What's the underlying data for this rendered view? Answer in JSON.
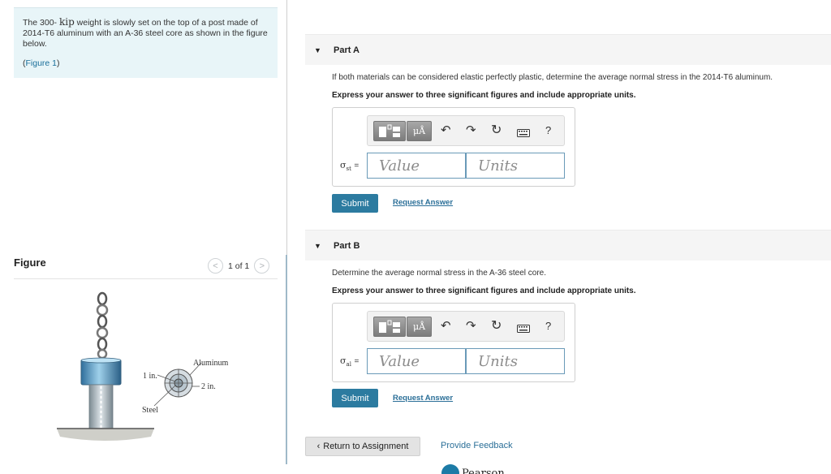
{
  "problem": {
    "text_before": "The 300-",
    "unit": "kip",
    "text_after": "weight is slowly set on the top of a post made of 2014-T6 aluminum with an A-36 steel core as shown in the figure below.",
    "figure_link": "Figure 1"
  },
  "figure_panel": {
    "heading": "Figure",
    "pager_text": "1 of 1",
    "prev_glyph": "<",
    "next_glyph": ">",
    "labels": {
      "aluminum": "Aluminum",
      "inner_dim": "1 in.",
      "outer_dim": "2 in.",
      "steel": "Steel"
    }
  },
  "parts": [
    {
      "title": "Part A",
      "caret": "▼",
      "question": "If both materials can be considered elastic perfectly plastic, determine the average normal stress in the 2014-T6 aluminum.",
      "instruction": "Express your answer to three significant figures and include appropriate units.",
      "symbol": "σ",
      "symbol_sub": "st",
      "equals": "=",
      "value_placeholder": "Value",
      "units_placeholder": "Units",
      "submit": "Submit",
      "request": "Request Answer"
    },
    {
      "title": "Part B",
      "caret": "▼",
      "question": "Determine the average normal stress in the A-36 steel core.",
      "instruction": "Express your answer to three significant figures and include appropriate units.",
      "symbol": "σ",
      "symbol_sub": "al",
      "equals": "=",
      "value_placeholder": "Value",
      "units_placeholder": "Units",
      "submit": "Submit",
      "request": "Request Answer"
    }
  ],
  "toolbar": {
    "units_button": "μÅ",
    "undo_icon": "↶",
    "redo_icon": "↷",
    "reset_icon": "↻",
    "keyboard_icon": "⌨",
    "help": "?"
  },
  "footer": {
    "return_arrow": "‹",
    "return_label": "Return to Assignment",
    "feedback": "Provide Feedback",
    "brand": "Pearson"
  },
  "colors": {
    "problem_bg": "#e8f5f8",
    "link": "#2b6f98",
    "submit_bg": "#2c7ba0",
    "input_border": "#6a9ab8"
  }
}
